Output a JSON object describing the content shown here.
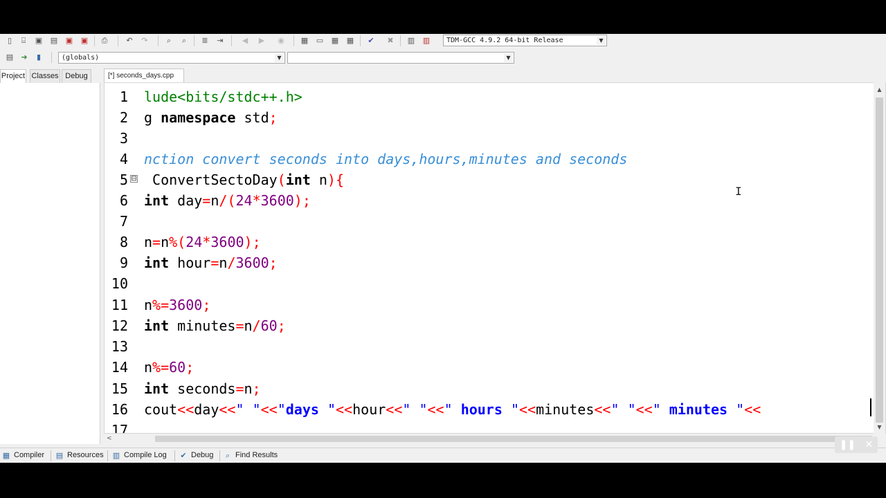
{
  "toolbar": {
    "compiler_select": "TDM-GCC 4.9.2 64-bit Release",
    "scope_select": "(globals)",
    "function_select": ""
  },
  "left_panel": {
    "tabs": [
      "Project",
      "Classes",
      "Debug"
    ],
    "active_tab": "Project"
  },
  "editor": {
    "file_tab": "[*] seconds_days.cpp",
    "line_numbers": [
      "1",
      "2",
      "3",
      "4",
      "5",
      "6",
      "7",
      "8",
      "9",
      "10",
      "11",
      "12",
      "13",
      "14",
      "15",
      "16",
      "17"
    ],
    "fold_marker": "⊟",
    "code": {
      "l1_inc": "lude<bits/stdc++.h>",
      "l2_a": "g ",
      "l2_kw": "namespace",
      "l2_b": " std",
      "l2_semi": ";",
      "l4_cmt": "nction convert seconds into days,hours,minutes and seconds",
      "l5_name": " ConvertSectoDay",
      "l5_paren": "(",
      "l5_kw": "int",
      "l5_arg": " n",
      "l5_close": "){",
      "l6_kw": "int",
      "l6_name": " day",
      "l6_eq": "=",
      "l6_n": "n",
      "l6_op": "/(",
      "l6_num1": "24",
      "l6_mul": "*",
      "l6_num2": "3600",
      "l6_end": ");",
      "l8_n1": "n",
      "l8_eq": "=",
      "l8_n2": "n",
      "l8_op": "%(",
      "l8_num1": "24",
      "l8_mul": "*",
      "l8_num2": "3600",
      "l8_end": ");",
      "l9_kw": "int",
      "l9_name": " hour",
      "l9_eq": "=",
      "l9_n": "n",
      "l9_op": "/",
      "l9_num": "3600",
      "l9_end": ";",
      "l11_n": "n",
      "l11_op": "%=",
      "l11_num": "3600",
      "l11_end": ";",
      "l12_kw": "int",
      "l12_name": " minutes",
      "l12_eq": "=",
      "l12_n": "n",
      "l12_op": "/",
      "l12_num": "60",
      "l12_end": ";",
      "l14_n": "n",
      "l14_op": "%=",
      "l14_num": "60",
      "l14_end": ";",
      "l15_kw": "int",
      "l15_name": " seconds",
      "l15_eq": "=",
      "l15_n": "n",
      "l15_end": ";",
      "l16_a": "cout",
      "l16_op1": "<<",
      "l16_b": "day",
      "l16_op2": "<<",
      "l16_s1": "\" \"",
      "l16_op3": "<<",
      "l16_s2": "\"",
      "l16_k1": "days",
      "l16_s3": " \"",
      "l16_op4": "<<",
      "l16_c": "hour",
      "l16_op5": "<<",
      "l16_s4": "\" \"",
      "l16_op6": "<<",
      "l16_s5": "\" ",
      "l16_k2": "hours",
      "l16_s6": " \"",
      "l16_op7": "<<",
      "l16_d": "minutes",
      "l16_op8": "<<",
      "l16_s7": "\" \"",
      "l16_op9": "<<",
      "l16_s8": "\" ",
      "l16_k3": "minutes",
      "l16_s9": " \"",
      "l16_op10": "<<"
    }
  },
  "bottom_tabs": [
    "Compiler",
    "Resources",
    "Compile Log",
    "Debug",
    "Find Results"
  ],
  "colors": {
    "keyword": "#000000",
    "include": "#008000",
    "comment": "#3a8fd6",
    "operator": "#ff0000",
    "number": "#800080",
    "string": "#0000ff"
  }
}
